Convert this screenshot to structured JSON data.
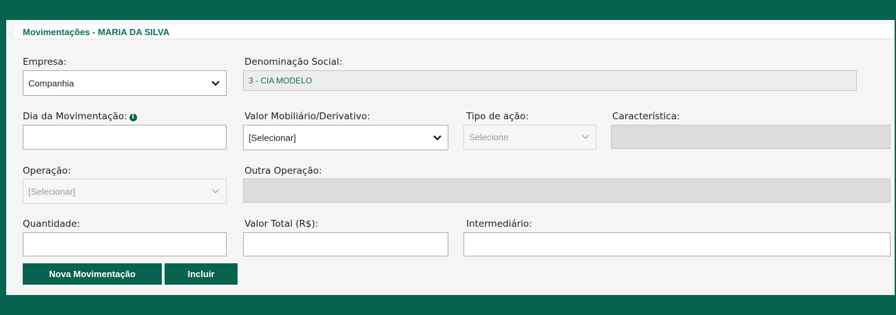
{
  "header": {
    "title": "Movimentações - MARIA DA SILVA"
  },
  "form": {
    "empresa": {
      "label": "Empresa:",
      "value": "Companhia"
    },
    "denominacao": {
      "label": "Denominação Social:",
      "value": "3 - CIA MODELO"
    },
    "dia": {
      "label": "Dia da Movimentação:",
      "info_icon": "info-icon",
      "value": ""
    },
    "valor_mobiliario": {
      "label": "Valor Mobiliário/Derivativo:",
      "value": "[Selecionar]"
    },
    "tipo_acao": {
      "label": "Tipo de ação:",
      "value": "Selecione"
    },
    "caracteristica": {
      "label": "Característica:",
      "value": ""
    },
    "operacao": {
      "label": "Operação:",
      "value": "[Selecionar]"
    },
    "outra_operacao": {
      "label": "Outra Operação:",
      "value": ""
    },
    "quantidade": {
      "label": "Quantidade:",
      "value": ""
    },
    "valor_total": {
      "label": "Valor Total (R$):",
      "value": ""
    },
    "intermediario": {
      "label": "Intermediário:",
      "value": ""
    }
  },
  "buttons": {
    "nova": "Nova Movimentação",
    "incluir": "Incluir"
  },
  "colors": {
    "brand": "#07634f",
    "title": "#0b6f5a",
    "panel": "#f5f5f5"
  }
}
